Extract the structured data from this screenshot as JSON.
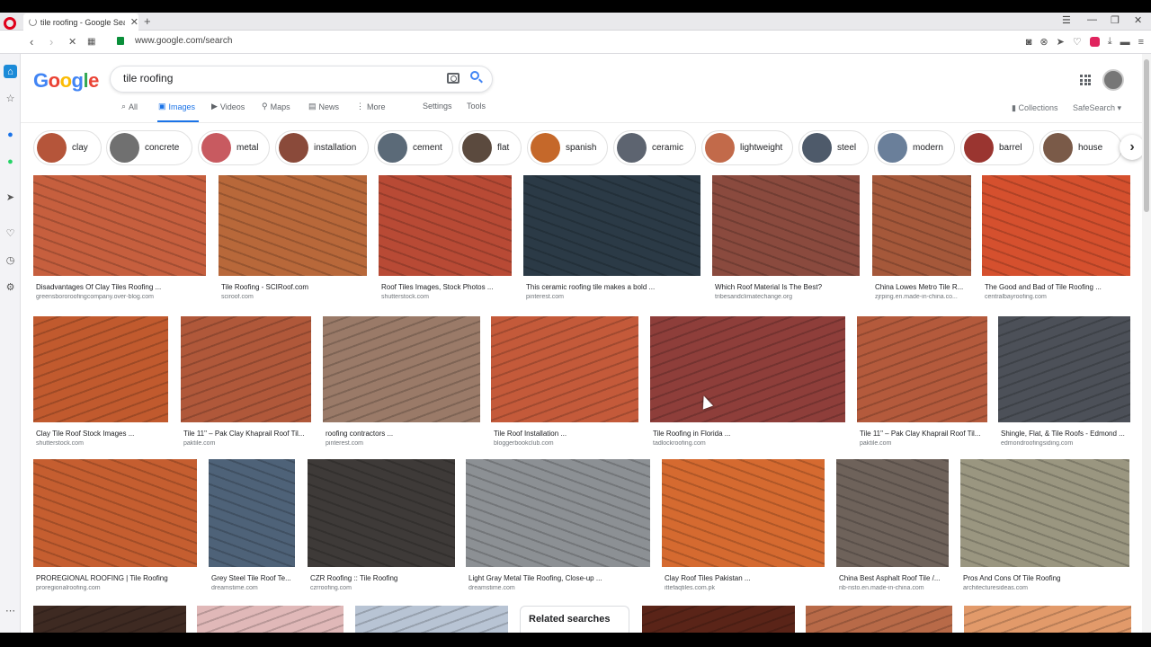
{
  "browser": {
    "tab_title": "tile roofing - Google Search",
    "tab_close": "✕",
    "new_tab": "+",
    "url": "www.google.com/search"
  },
  "google": {
    "logo": [
      "G",
      "o",
      "o",
      "g",
      "l",
      "e"
    ],
    "logo_colors": [
      "#4285f4",
      "#ea4335",
      "#fbbc05",
      "#4285f4",
      "#34a853",
      "#ea4335"
    ],
    "query": "tile roofing",
    "tabs": [
      "All",
      "Images",
      "Videos",
      "Maps",
      "News",
      "More"
    ],
    "settings": "Settings",
    "tools": "Tools",
    "collections": "Collections",
    "safesearch": "SafeSearch ▾"
  },
  "chips": [
    {
      "label": "clay",
      "color": "#b5553a"
    },
    {
      "label": "concrete",
      "color": "#707070"
    },
    {
      "label": "metal",
      "color": "#c85a60"
    },
    {
      "label": "installation",
      "color": "#8a4a3a"
    },
    {
      "label": "cement",
      "color": "#5b6a78"
    },
    {
      "label": "flat",
      "color": "#5b4a3e"
    },
    {
      "label": "spanish",
      "color": "#c5682a"
    },
    {
      "label": "ceramic",
      "color": "#5d6470"
    },
    {
      "label": "lightweight",
      "color": "#c26a4a"
    },
    {
      "label": "steel",
      "color": "#4e5a6a"
    },
    {
      "label": "modern",
      "color": "#6a7f9a"
    },
    {
      "label": "barrel",
      "color": "#9a3530"
    },
    {
      "label": "house",
      "color": "#7a5a48"
    }
  ],
  "rows": [
    [
      {
        "caption": "Disadvantages Of Clay Tiles Roofing ...",
        "source": "greensbororoofingcompany.over-blog.com",
        "color": "#c65f3e"
      },
      {
        "caption": "Tile Roofing - SCIRoof.com",
        "source": "sciroof.com",
        "color": "#b8683a"
      },
      {
        "caption": "Roof Tiles Images, Stock Photos ...",
        "source": "shutterstock.com",
        "color": "#b84a35"
      },
      {
        "caption": "This ceramic roofing tile makes a bold ...",
        "source": "pinterest.com",
        "color": "#2b3a46"
      },
      {
        "caption": "Which Roof Material Is The Best?",
        "source": "tribesandclimatechange.org",
        "color": "#8a4a3e"
      },
      {
        "caption": "China Lowes Metro Tile R...",
        "source": "zjrping.en.made-in-china.co...",
        "color": "#a5583a"
      },
      {
        "caption": "The Good and Bad of Tile Roofing ...",
        "source": "centralbayroofing.com",
        "color": "#d5502e"
      }
    ],
    [
      {
        "caption": "Clay Tile Roof Stock Images ...",
        "source": "shutterstock.com",
        "color": "#c15a2e"
      },
      {
        "caption": "Tile 11\" – Pak Clay Khaprail Roof Til...",
        "source": "paktile.com",
        "color": "#b0583a"
      },
      {
        "caption": "roofing contractors ...",
        "source": "pinterest.com",
        "color": "#9a7a68"
      },
      {
        "caption": "Tile Roof Installation ...",
        "source": "bloggerbookclub.com",
        "color": "#c45a3a"
      },
      {
        "caption": "Tile Roofing in Florida ...",
        "source": "tadlockroofing.com",
        "color": "#8e3e3a"
      },
      {
        "caption": "Tile 11\" – Pak Clay Khaprail Roof Til...",
        "source": "paktile.com",
        "color": "#b45a3c"
      },
      {
        "caption": "Shingle, Flat, & Tile Roofs - Edmond ...",
        "source": "edmondroofingsiding.com",
        "color": "#4c5058"
      }
    ],
    [
      {
        "caption": "PROREGIONAL ROOFING | Tile Roofing",
        "source": "proregionalroofing.com",
        "color": "#c55e30"
      },
      {
        "caption": "Grey Steel Tile Roof Te...",
        "source": "dreamstime.com",
        "color": "#4e6278"
      },
      {
        "caption": "CZR Roofing :: Tile Roofing",
        "source": "czrroofing.com",
        "color": "#3e3a38"
      },
      {
        "caption": "Light Gray Metal Tile Roofing, Close-up ...",
        "source": "dreamstime.com",
        "color": "#8c9094"
      },
      {
        "caption": "Clay Roof Tiles Pakistan ...",
        "source": "ittefaqtiles.com.pk",
        "color": "#d56a30"
      },
      {
        "caption": "China Best Asphalt Roof Tile /...",
        "source": "nb-nsto.en.made-in-china.com",
        "color": "#6e625a"
      },
      {
        "caption": "Pros And Cons Of Tile Roofing",
        "source": "architecturesideas.com",
        "color": "#9a9680"
      }
    ],
    [
      {
        "color": "#3e2a22"
      },
      {
        "color": "#e0b8b8"
      },
      {
        "color": "#b8c4d4"
      },
      {
        "color": "#5a2418"
      },
      {
        "color": "#b86a48"
      },
      {
        "color": "#e29a6a"
      }
    ]
  ],
  "related": "Related searches"
}
